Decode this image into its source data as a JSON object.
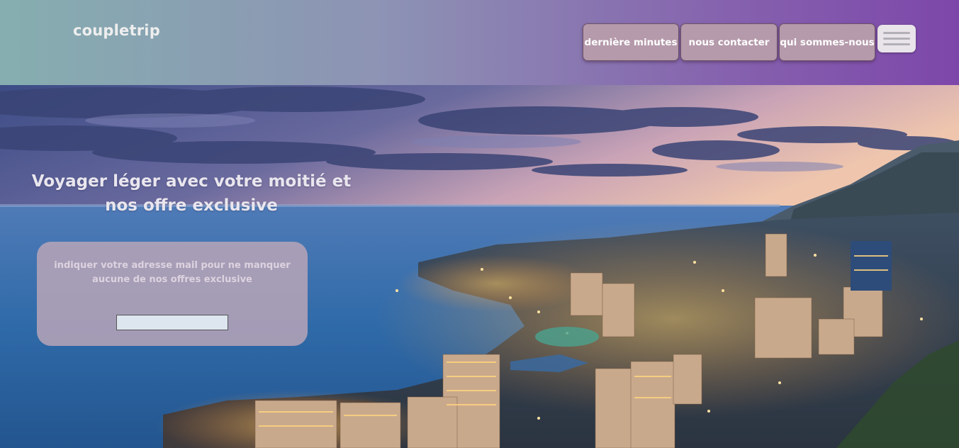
{
  "header": {
    "brand": "coupletrip",
    "nav": [
      {
        "label": "dernière minutes"
      },
      {
        "label": "nous contacter"
      },
      {
        "label": "qui sommes-nous"
      }
    ],
    "menu_icon": "hamburger-menu-icon"
  },
  "hero": {
    "title_line1": "Voyager léger avec votre moitié et",
    "title_line2": "nos offre exclusive",
    "signup_text_line1": "indiquer votre adresse mail pour ne manquer",
    "signup_text_line2": "aucune de nos offres exclusive",
    "email_value": "",
    "email_placeholder": ""
  },
  "colors": {
    "header_left": "#86aeb0",
    "header_right": "#7d47aa",
    "nav_button": "#b59aab",
    "signup_box": "#b8a4b8"
  }
}
